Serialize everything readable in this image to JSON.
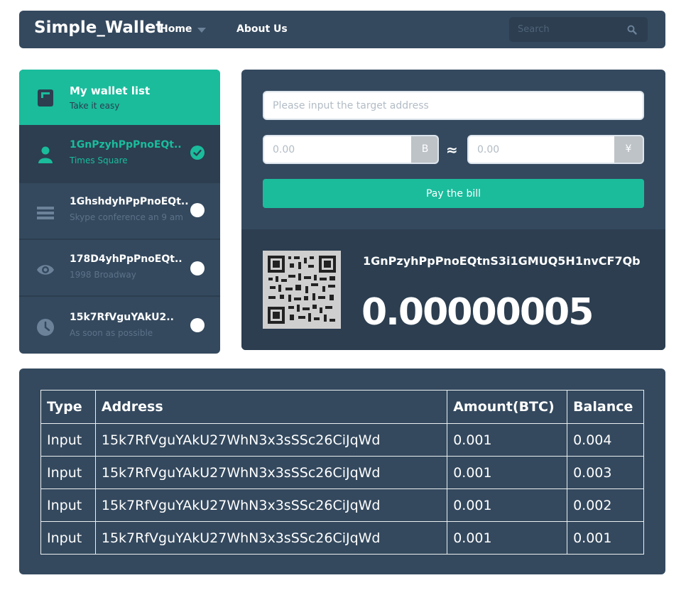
{
  "navbar": {
    "brand": "Simple_Wallet",
    "home_label": "Home",
    "about_label": "About Us",
    "search_placeholder": "Search"
  },
  "sidebar": {
    "header": {
      "title": "My wallet list",
      "subtitle": "Take it easy",
      "icon": "wallet-icon"
    },
    "items": [
      {
        "title": "1GnPzyhPpPnoEQt..",
        "subtitle": "Times Square",
        "icon": "user-icon",
        "selected": true
      },
      {
        "title": "1GhshdyhPpPnoEQt..",
        "subtitle": "Skype conference an 9 am",
        "icon": "list-icon",
        "selected": false
      },
      {
        "title": "178D4yhPpPnoEQt..",
        "subtitle": "1998 Broadway",
        "icon": "eye-icon",
        "selected": false
      },
      {
        "title": "15k7RfVguYAkU2..",
        "subtitle": "As soon as possible",
        "icon": "clock-icon",
        "selected": false
      }
    ]
  },
  "payment": {
    "address_placeholder": "Please input the target address",
    "btc_placeholder": "0.00",
    "btc_addon": "B",
    "approx": "≈",
    "cny_placeholder": "0.00",
    "cny_addon": "¥",
    "pay_label": "Pay the bill"
  },
  "wallet": {
    "address": "1GnPzyhPpPnoEQtnS3i1GMUQ5H1nvCF7Qb",
    "balance": "0.00000005"
  },
  "transactions": {
    "headers": [
      "Type",
      "Address",
      "Amount(BTC)",
      "Balance"
    ],
    "rows": [
      [
        "Input",
        "15k7RfVguYAkU27WhN3x3sSSc26CiJqWd",
        "0.001",
        "0.004"
      ],
      [
        "Input",
        "15k7RfVguYAkU27WhN3x3sSSc26CiJqWd",
        "0.001",
        "0.003"
      ],
      [
        "Input",
        "15k7RfVguYAkU27WhN3x3sSSc26CiJqWd",
        "0.001",
        "0.002"
      ],
      [
        "Input",
        "15k7RfVguYAkU27WhN3x3sSSc26CiJqWd",
        "0.001",
        "0.001"
      ]
    ]
  },
  "colors": {
    "panel": "#34495e",
    "dark": "#2c3e50",
    "accent": "#1abc9c",
    "muted": "#bdc3c7"
  }
}
